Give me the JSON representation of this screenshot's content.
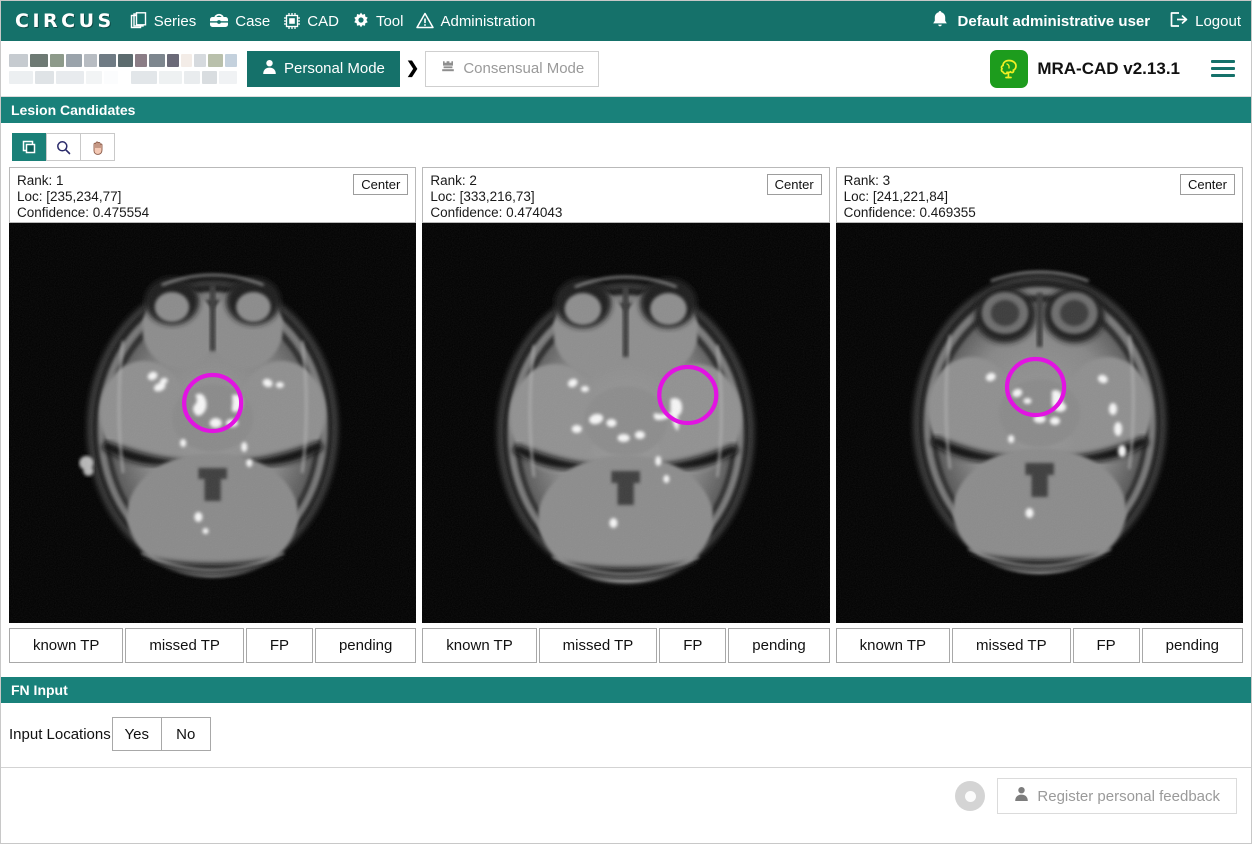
{
  "topnav": {
    "brand": "CIRCUS",
    "items": [
      {
        "label": "Series",
        "icon": "pages-icon"
      },
      {
        "label": "Case",
        "icon": "briefcase-icon"
      },
      {
        "label": "CAD",
        "icon": "chip-icon"
      },
      {
        "label": "Tool",
        "icon": "gear-icon"
      },
      {
        "label": "Administration",
        "icon": "warning-triangle-icon"
      }
    ],
    "user": "Default administrative user",
    "user_icon": "bell-icon",
    "logout": "Logout",
    "logout_icon": "logout-icon",
    "bg_color": "#15716a"
  },
  "modebar": {
    "patient_redacted": true,
    "personal_mode": "Personal Mode",
    "personal_mode_icon": "user-icon",
    "consensual_mode": "Consensual Mode",
    "consensual_mode_icon": "group-icon",
    "arrow": "❯",
    "app_name": "MRA-CAD v2.13.1",
    "app_logo_icon": "brain-icon",
    "menu_icon": "hamburger-icon",
    "accent_color": "#15716a",
    "logo_bg": "#1d9c1d",
    "logo_fg": "#f2f024"
  },
  "lesion_section": {
    "title": "Lesion Candidates",
    "toolbar": [
      {
        "name": "window-level-icon",
        "active": true
      },
      {
        "name": "magnifier-icon",
        "active": false
      },
      {
        "name": "pan-hand-icon",
        "active": false
      }
    ],
    "center_label": "Center",
    "label_buttons": [
      "known TP",
      "missed TP",
      "FP",
      "pending"
    ],
    "candidates": [
      {
        "rank": "Rank: 1",
        "loc": "Loc: [235,234,77]",
        "confidence": "Confidence: 0.475554"
      },
      {
        "rank": "Rank: 2",
        "loc": "Loc: [333,216,73]",
        "confidence": "Confidence: 0.474043"
      },
      {
        "rank": "Rank: 3",
        "loc": "Loc: [241,221,84]",
        "confidence": "Confidence: 0.469355"
      }
    ],
    "marker_color": "#e213e2"
  },
  "fn_input": {
    "title": "FN Input",
    "label": "Input Locations",
    "yes": "Yes",
    "no": "No"
  },
  "footer": {
    "spinner_name": "progress-indicator",
    "register_label": "Register personal feedback",
    "register_icon": "user-icon"
  }
}
